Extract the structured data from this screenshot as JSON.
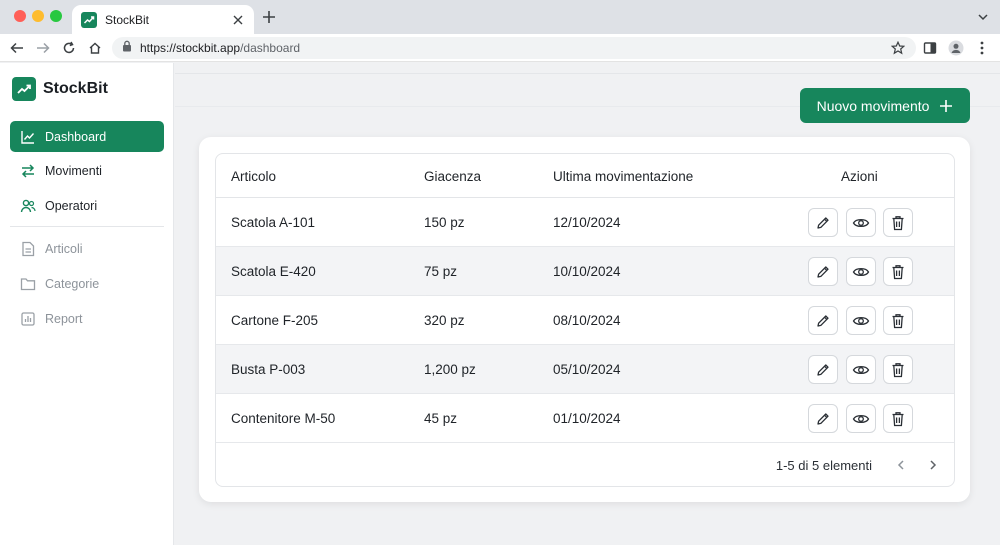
{
  "browser": {
    "tab_title": "StockBit",
    "url_host": "https://stockbit.app",
    "url_path": "/dashboard"
  },
  "sidebar": {
    "brand": "StockBit",
    "primary_items": [
      {
        "label": "Dashboard",
        "icon": "chart-line-icon",
        "active": true
      },
      {
        "label": "Movimenti",
        "icon": "arrows-exchange-icon",
        "active": false
      },
      {
        "label": "Operatori",
        "icon": "users-icon",
        "active": false
      }
    ],
    "secondary_items": [
      {
        "label": "Articoli",
        "icon": "document-icon"
      },
      {
        "label": "Categorie",
        "icon": "folder-icon"
      },
      {
        "label": "Report",
        "icon": "bar-report-icon"
      }
    ]
  },
  "main": {
    "new_button_label": "Nuovo movimento",
    "table": {
      "headers": [
        "Articolo",
        "Giacenza",
        "Ultima movimentazione",
        "Azioni"
      ],
      "rows": [
        {
          "articolo": "Scatola A-101",
          "giacenza": "150 pz",
          "data": "12/10/2024"
        },
        {
          "articolo": "Scatola E-420",
          "giacenza": "75 pz",
          "data": "10/10/2024"
        },
        {
          "articolo": "Cartone F-205",
          "giacenza": "320 pz",
          "data": "08/10/2024"
        },
        {
          "articolo": "Busta P-003",
          "giacenza": "1,200 pz",
          "data": "05/10/2024"
        },
        {
          "articolo": "Contenitore M-50",
          "giacenza": "45 pz",
          "data": "01/10/2024"
        }
      ],
      "action_icons": [
        "pencil-icon",
        "eye-icon",
        "trash-icon"
      ]
    },
    "pagination": {
      "text": "1-5 di 5 elementi"
    }
  },
  "colors": {
    "accent": "#17865c",
    "background": "#f0f1f3"
  }
}
